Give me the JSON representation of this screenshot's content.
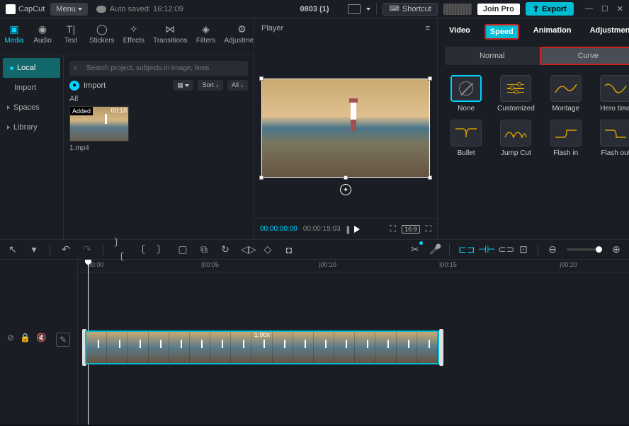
{
  "topbar": {
    "logo": "CapCut",
    "menu": "Menu",
    "autosave": "Auto saved: 16:12:09",
    "title": "0803 (1)",
    "shortcut": "Shortcut",
    "joinpro": "Join Pro",
    "export": "Export"
  },
  "tabs": {
    "media": "Media",
    "audio": "Audio",
    "text": "Text",
    "stickers": "Stickers",
    "effects": "Effects",
    "transitions": "Transitions",
    "filters": "Filters",
    "adjustment": "Adjustment"
  },
  "sidebar": {
    "local": "Local",
    "import": "Import",
    "spaces": "Spaces",
    "library": "Library"
  },
  "media": {
    "search_placeholder": "Search project, subjects in image, lines",
    "import": "Import",
    "sort": "Sort",
    "all": "All",
    "all_label": "All",
    "thumb_added": "Added",
    "thumb_dur": "00:18",
    "thumb_name": "1.mp4"
  },
  "player": {
    "title": "Player",
    "time_current": "00:00:00:00",
    "time_total": "00:00:15:03",
    "ratio": "16:9"
  },
  "right": {
    "tabs": {
      "video": "Video",
      "speed": "Speed",
      "animation": "Animation",
      "adjustment": "Adjustment"
    },
    "modes": {
      "normal": "Normal",
      "curve": "Curve"
    },
    "presets": {
      "none": "None",
      "customized": "Customized",
      "montage": "Montage",
      "hero_time": "Hero time",
      "bullet": "Bullet",
      "jump_cut": "Jump Cut",
      "flash_in": "Flash in",
      "flash_out": "Flash out"
    }
  },
  "timeline": {
    "ticks": [
      "00:00",
      "|00:05",
      "|00:10",
      "|00:15",
      "|00:20"
    ],
    "clip_speed": "1.00x"
  }
}
